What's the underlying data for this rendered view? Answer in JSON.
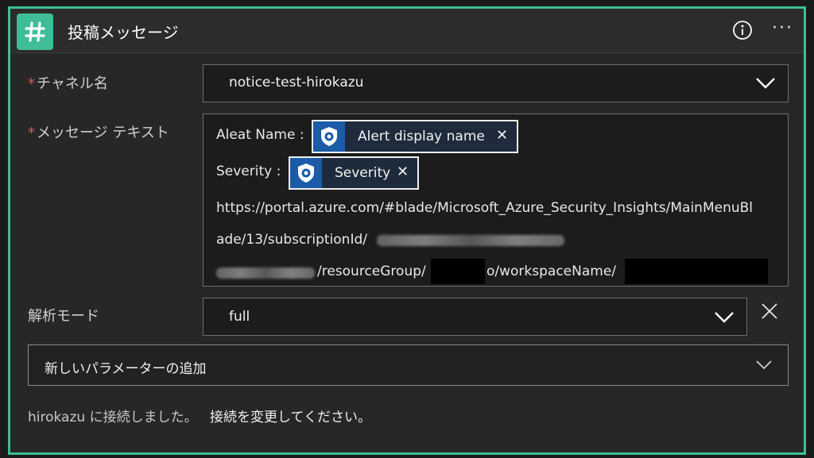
{
  "header": {
    "title": "投稿メッセージ",
    "app_icon": "slack-hash-icon",
    "info_icon": "info-icon",
    "more_label": "···"
  },
  "required_marker": "*",
  "channel": {
    "label": "チャネル名",
    "value": "notice-test-hirokazu"
  },
  "message": {
    "label": "メッセージ テキスト",
    "line1_prefix": "Aleat Name :",
    "token1_label": "Alert display name",
    "line2_prefix": "Severity :",
    "token2_label": "Severity",
    "token_close": "✕",
    "url_line1": "https://portal.azure.com/#blade/Microsoft_Azure_Security_Insights/MainMenuBl",
    "url_line2": "ade/13/subscriptionId/",
    "url_line3_a": "/resourceGroup/",
    "url_line3_b": "o/workspaceName/"
  },
  "parse_mode": {
    "label": "解析モード",
    "value": "full"
  },
  "add_parameter": {
    "label": "新しいパラメーターの追加"
  },
  "footer": {
    "connection_text": "hirokazu に接続しました。",
    "change_link": "接続を変更してください。"
  },
  "colors": {
    "accent": "#3fbd97",
    "token_icon": "#1b5ba8",
    "required": "#e05555"
  }
}
